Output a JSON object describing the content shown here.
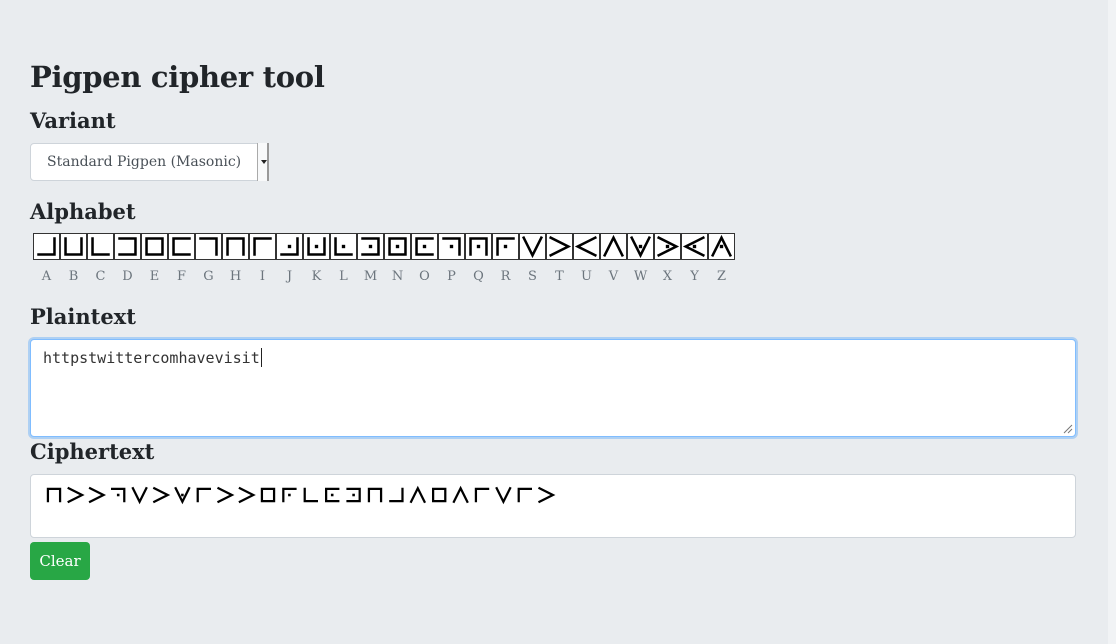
{
  "page": {
    "title": "Pigpen cipher tool"
  },
  "variant": {
    "heading": "Variant",
    "selected": "Standard Pigpen (Masonic)"
  },
  "alphabet": {
    "heading": "Alphabet",
    "letters": [
      "A",
      "B",
      "C",
      "D",
      "E",
      "F",
      "G",
      "H",
      "I",
      "J",
      "K",
      "L",
      "M",
      "N",
      "O",
      "P",
      "Q",
      "R",
      "S",
      "T",
      "U",
      "V",
      "W",
      "X",
      "Y",
      "Z"
    ]
  },
  "plaintext": {
    "heading": "Plaintext",
    "value": "httpstwittercomhavevisit"
  },
  "ciphertext": {
    "heading": "Ciphertext"
  },
  "actions": {
    "clear_label": "Clear"
  },
  "colors": {
    "clear_button": "#28a745",
    "focus_border": "#80bdff",
    "background": "#e9ecef"
  }
}
